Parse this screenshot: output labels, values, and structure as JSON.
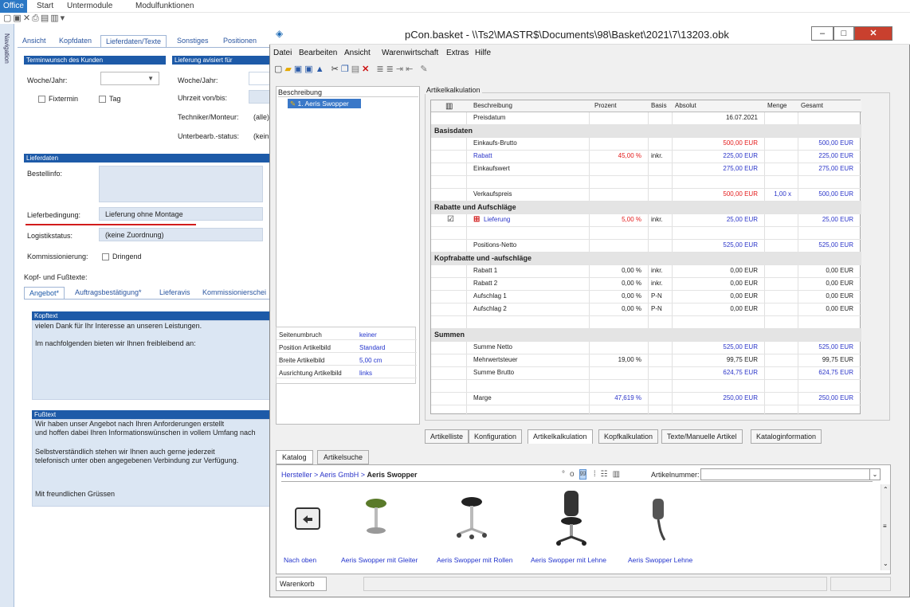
{
  "ribbon": {
    "tabs": [
      "Office",
      "Start",
      "Untermodule",
      "Modulfunktionen"
    ]
  },
  "nav": {
    "label": "Navigation"
  },
  "form": {
    "tabs": [
      "Ansicht",
      "Kopfdaten",
      "Lieferdaten/Texte",
      "Sonstiges",
      "Positionen"
    ],
    "termin": {
      "header": "Terminwunsch des Kunden",
      "woche_label": "Woche/Jahr:",
      "fixtermin": "Fixtermin",
      "tag": "Tag"
    },
    "liefer": {
      "header": "Lieferung avisiert für",
      "woche": "Woche/Jahr:",
      "uhrzeit": "Uhrzeit von/bis:",
      "techniker": "Techniker/Monteur:",
      "techniker_val": "(alle)",
      "unterbearb": "Unterbearb.-status:",
      "unterbearb_val": "(kein"
    },
    "lieferdaten": {
      "header": "Lieferdaten",
      "bestellinfo": "Bestellinfo:",
      "bedingung_label": "Lieferbedingung:",
      "bedingung": "Lieferung ohne Montage",
      "logistik_label": "Logistikstatus:",
      "logistik": "(keine Zuordnung)",
      "kommission_label": "Kommissionierung:",
      "dringend": "Dringend"
    },
    "texte_label": "Kopf- und Fußtexte:",
    "texttabs": [
      "Angebot*",
      "Auftragsbestätigung*",
      "Lieferavis",
      "Kommissionierschei"
    ],
    "kopftext": {
      "header": "Kopftext",
      "l1": "vielen Dank für Ihr Interesse an unseren Leistungen.",
      "l2": "Im nachfolgenden bieten wir Ihnen freibleibend an:"
    },
    "fusstext": {
      "header": "Fußtext",
      "l1": "Wir haben unser Angebot nach Ihren Anforderungen erstellt",
      "l2": "und hoffen dabei Ihren Informationswünschen in vollem Umfang nach",
      "l3": "Selbstverständlich stehen wir Ihnen auch gerne jederzeit",
      "l4": "telefonisch unter oben angegebenen Verbindung zur Verfügung.",
      "l5": "Mit freundlichen Grüssen"
    }
  },
  "dialog": {
    "title": "pCon.basket - \\\\Ts2\\MASTR$\\Documents\\98\\Basket\\2021\\7\\13203.obk",
    "menu": [
      "Datei",
      "Bearbeiten",
      "Ansicht",
      "Warenwirtschaft",
      "Extras",
      "Hilfe"
    ],
    "tree": {
      "header": "Beschreibung",
      "item": "1. Aeris Swopper"
    },
    "props": [
      [
        "Seitenumbruch",
        "keiner"
      ],
      [
        "Position Artikelbild",
        "Standard"
      ],
      [
        "Breite Artikelbild",
        "5,00 cm"
      ],
      [
        "Ausrichtung Artikelbild",
        "links"
      ]
    ],
    "kalk_title": "Artikelkalkulation",
    "cols": [
      "Beschreibung",
      "Prozent",
      "Basis",
      "Absolut",
      "Menge",
      "Gesamt"
    ],
    "rows": [
      {
        "sec": false,
        "b": "Preisdatum",
        "p": "",
        "ba": "",
        "a": "16.07.2021",
        "m": "",
        "g": ""
      },
      {
        "sec": true,
        "b": "Basisdaten"
      },
      {
        "sec": false,
        "b": "Einkaufs-Brutto",
        "p": "",
        "ba": "",
        "a": "500,00 EUR",
        "m": "",
        "g": "500,00 EUR",
        "ac": "red",
        "gc": "blue"
      },
      {
        "sec": false,
        "b": "Rabatt",
        "p": "45,00 %",
        "ba": "inkr.",
        "a": "225,00 EUR",
        "m": "",
        "g": "225,00 EUR",
        "bc": "blue",
        "pc": "red",
        "ac": "blue",
        "gc": "blue"
      },
      {
        "sec": false,
        "b": "Einkaufswert",
        "p": "",
        "ba": "",
        "a": "275,00 EUR",
        "m": "",
        "g": "275,00 EUR",
        "ac": "blue",
        "gc": "blue"
      },
      {
        "sec": false,
        "b": "",
        "p": "",
        "ba": "",
        "a": "",
        "m": "",
        "g": ""
      },
      {
        "sec": false,
        "b": "Verkaufspreis",
        "p": "",
        "ba": "",
        "a": "500,00 EUR",
        "m": "1,00 x",
        "g": "500,00 EUR",
        "ac": "red",
        "mc": "blue",
        "gc": "blue"
      },
      {
        "sec": true,
        "b": "Rabatte und Aufschläge"
      },
      {
        "sec": false,
        "b": "Lieferung",
        "p": "5,00 %",
        "ba": "inkr.",
        "a": "25,00 EUR",
        "m": "",
        "g": "25,00 EUR",
        "bc": "blue",
        "pc": "red",
        "ac": "blue",
        "gc": "blue",
        "check": true
      },
      {
        "sec": false,
        "b": "",
        "p": "",
        "ba": "",
        "a": "",
        "m": "",
        "g": ""
      },
      {
        "sec": false,
        "b": "Positions-Netto",
        "p": "",
        "ba": "",
        "a": "525,00 EUR",
        "m": "",
        "g": "525,00 EUR",
        "ac": "blue",
        "gc": "blue"
      },
      {
        "sec": true,
        "b": "Kopfrabatte und -aufschläge"
      },
      {
        "sec": false,
        "b": "Rabatt 1",
        "p": "0,00 %",
        "ba": "inkr.",
        "a": "0,00 EUR",
        "m": "",
        "g": "0,00 EUR"
      },
      {
        "sec": false,
        "b": "Rabatt 2",
        "p": "0,00 %",
        "ba": "inkr.",
        "a": "0,00 EUR",
        "m": "",
        "g": "0,00 EUR"
      },
      {
        "sec": false,
        "b": "Aufschlag 1",
        "p": "0,00 %",
        "ba": "P-N",
        "a": "0,00 EUR",
        "m": "",
        "g": "0,00 EUR"
      },
      {
        "sec": false,
        "b": "Aufschlag 2",
        "p": "0,00 %",
        "ba": "P-N",
        "a": "0,00 EUR",
        "m": "",
        "g": "0,00 EUR"
      },
      {
        "sec": false,
        "b": "",
        "p": "",
        "ba": "",
        "a": "",
        "m": "",
        "g": ""
      },
      {
        "sec": true,
        "b": "Summen"
      },
      {
        "sec": false,
        "b": "Summe Netto",
        "p": "",
        "ba": "",
        "a": "525,00 EUR",
        "m": "",
        "g": "525,00 EUR",
        "ac": "blue",
        "gc": "blue"
      },
      {
        "sec": false,
        "b": "Mehrwertsteuer",
        "p": "19,00 %",
        "ba": "",
        "a": "99,75 EUR",
        "m": "",
        "g": "99,75 EUR"
      },
      {
        "sec": false,
        "b": "Summe Brutto",
        "p": "",
        "ba": "",
        "a": "624,75 EUR",
        "m": "",
        "g": "624,75 EUR",
        "ac": "blue",
        "gc": "blue"
      },
      {
        "sec": false,
        "b": "",
        "p": "",
        "ba": "",
        "a": "",
        "m": "",
        "g": ""
      },
      {
        "sec": false,
        "b": "Marge",
        "p": "47,619 %",
        "ba": "",
        "a": "250,00 EUR",
        "m": "",
        "g": "250,00 EUR",
        "pc": "blue",
        "ac": "blue",
        "gc": "blue"
      }
    ],
    "bottomtabs": [
      "Artikelliste",
      "Konfiguration",
      "Artikelkalkulation",
      "Kopfkalkulation",
      "Texte/Manuelle Artikel",
      "Kataloginformation"
    ],
    "katalog": {
      "tabs": [
        "Katalog",
        "Artikelsuche"
      ],
      "breadcrumb_pre": "Hersteller > Aeris GmbH > ",
      "breadcrumb_cur": "Aeris Swopper",
      "artnr_label": "Artikelnummer:",
      "items": [
        "Nach oben",
        "Aeris Swopper mit Gleiter",
        "Aeris Swopper mit Rollen",
        "Aeris Swopper mit Lehne",
        "Aeris Swopper Lehne"
      ]
    },
    "status": "Warenkorb"
  }
}
